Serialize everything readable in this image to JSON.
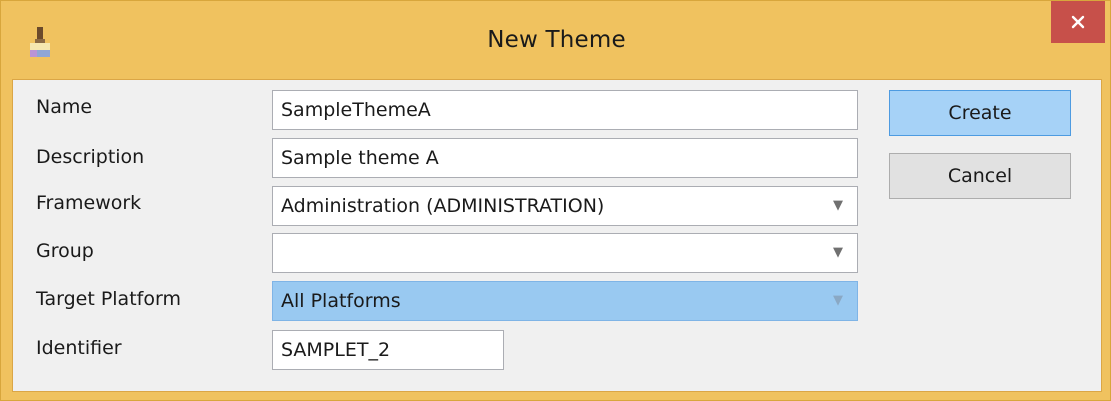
{
  "window": {
    "title": "New Theme",
    "icons": {
      "app": "paint-brush-icon",
      "close": "close-icon"
    },
    "colors": {
      "frame": "#f0c25f",
      "close_button": "#c7504a",
      "primary_button": "#a6d2f7",
      "selection": "#99c9f1"
    }
  },
  "form": {
    "name": {
      "label": "Name",
      "value": "SampleThemeA"
    },
    "description": {
      "label": "Description",
      "value": "Sample theme A"
    },
    "framework": {
      "label": "Framework",
      "value": "Administration (ADMINISTRATION)"
    },
    "group": {
      "label": "Group",
      "value": ""
    },
    "target_platform": {
      "label": "Target Platform",
      "value": "All Platforms"
    },
    "identifier": {
      "label": "Identifier",
      "value": "SAMPLET_2"
    }
  },
  "buttons": {
    "create": "Create",
    "cancel": "Cancel"
  }
}
